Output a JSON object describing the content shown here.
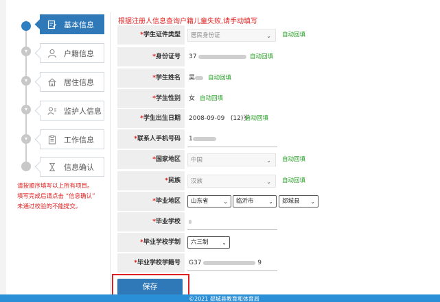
{
  "sidebar": {
    "steps": [
      {
        "label": "基本信息",
        "icon": "form-edit-icon"
      },
      {
        "label": "户籍信息",
        "icon": "person-icon"
      },
      {
        "label": "居住信息",
        "icon": "home-icon"
      },
      {
        "label": "监护人信息",
        "icon": "guardian-icon"
      },
      {
        "label": "工作信息",
        "icon": "clipboard-icon"
      },
      {
        "label": "信息确认",
        "icon": "hourglass-icon"
      }
    ],
    "notes": [
      "请按顺序填写以上所有项目。",
      "填写完成后请点击 “信息确认”",
      "未通过校验的不能提交。"
    ]
  },
  "form": {
    "tip": "根据注册人信息查询户籍儿童失败,请手动填写",
    "auto_fill": "自动回填",
    "fields": {
      "id_type": {
        "label": "学生证件类型",
        "value": "居民身份证"
      },
      "id_number": {
        "label": "身份证号",
        "value": "37"
      },
      "name": {
        "label": "学生姓名",
        "value": "吴"
      },
      "gender": {
        "label": "学生性别",
        "value": "女"
      },
      "birth": {
        "label": "学生出生日期",
        "value": "2008-09-09",
        "age": "(12)岁"
      },
      "phone": {
        "label": "联系人手机号码",
        "value": "1"
      },
      "country": {
        "label": "国家地区",
        "value": "中国"
      },
      "ethnicity": {
        "label": "民族",
        "value": "汉族"
      },
      "grad_region": {
        "label": "毕业地区",
        "province": "山东省",
        "city": "临沂市",
        "county": "郯城县"
      },
      "grad_school": {
        "label": "毕业学校",
        "value": ""
      },
      "school_system": {
        "label": "毕业学校学制",
        "value": "六三制"
      },
      "student_no": {
        "label": "毕业学校学籍号",
        "value_start": "G37",
        "value_end": "9"
      }
    },
    "save_label": "保存"
  },
  "footer": {
    "text": "©2021  郯城县教育和体育局"
  },
  "colors": {
    "accent": "#2f79b9",
    "warning": "#e02020",
    "auto": "#1d9a1d",
    "footer": "#2a8fd6"
  }
}
